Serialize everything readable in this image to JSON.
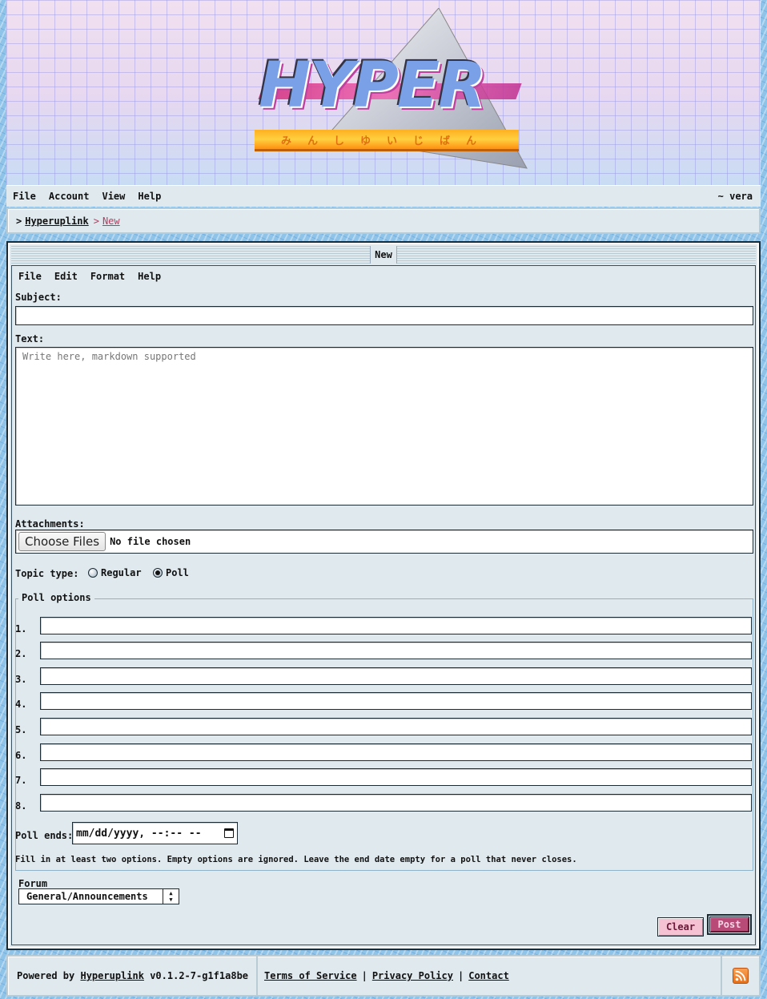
{
  "banner": {
    "logo_text": "HYPER",
    "logo_subtitle": "みんしゆいじばん"
  },
  "menubar": {
    "items": [
      {
        "label": "File"
      },
      {
        "label": "Account"
      },
      {
        "label": "View"
      },
      {
        "label": "Help"
      }
    ],
    "user": "~ vera"
  },
  "breadcrumb": {
    "separator": ">",
    "home": "Hyperuplink",
    "current": "New"
  },
  "window": {
    "title": "New",
    "menu": [
      {
        "label": "File"
      },
      {
        "label": "Edit"
      },
      {
        "label": "Format"
      },
      {
        "label": "Help"
      }
    ]
  },
  "form": {
    "subject_label": "Subject:",
    "subject_value": "",
    "text_label": "Text:",
    "text_placeholder": "Write here, markdown supported",
    "attachments_label": "Attachments:",
    "choose_files": "Choose Files",
    "no_file": "No file chosen",
    "topic_type_label": "Topic type:",
    "topic_types": [
      {
        "label": "Regular",
        "selected": false
      },
      {
        "label": "Poll",
        "selected": true
      }
    ],
    "poll_legend": "Poll options",
    "poll_options": [
      "1.",
      "2.",
      "3.",
      "4.",
      "5.",
      "6.",
      "7.",
      "8."
    ],
    "poll_ends_label": "Poll ends:",
    "poll_ends_placeholder": "mm/dd/yyyy, --:-- --",
    "hint": "Fill in at least two options. Empty options are ignored. Leave the end date empty for a poll that never closes.",
    "forum_label": "Forum",
    "forum_value": "General/Announcements",
    "clear_label": "Clear",
    "post_label": "Post"
  },
  "footer": {
    "powered_prefix": "Powered by",
    "powered_link": "Hyperuplink",
    "version": "v0.1.2-7-g1f1a8be",
    "links": [
      "Terms of Service",
      "Privacy Policy",
      "Contact"
    ],
    "separator": "|"
  },
  "colors": {
    "accent": "#b84a78",
    "panel": "#dfe9ee",
    "breadcrumb_current": "#b04060"
  }
}
